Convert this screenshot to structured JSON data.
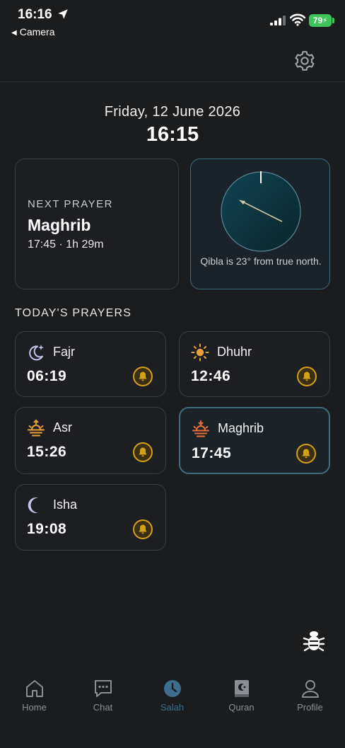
{
  "status_bar": {
    "time": "16:16",
    "back_label": "Camera",
    "battery": "79"
  },
  "header": {
    "date": "Friday, 12 June 2026",
    "clock": "16:15"
  },
  "next_prayer": {
    "label": "NEXT PRAYER",
    "name": "Maghrib",
    "time_info": "17:45 · 1h 29m"
  },
  "qibla": {
    "text": "Qibla is 23° from true north.",
    "degrees": 23
  },
  "prayers_section": {
    "title": "TODAY'S PRAYERS",
    "items": [
      {
        "name": "Fajr",
        "time": "06:19",
        "icon": "moon-star-icon",
        "active": false
      },
      {
        "name": "Dhuhr",
        "time": "12:46",
        "icon": "sun-icon",
        "active": false
      },
      {
        "name": "Asr",
        "time": "15:26",
        "icon": "sunset-icon",
        "active": false
      },
      {
        "name": "Maghrib",
        "time": "17:45",
        "icon": "sunset-down-icon",
        "active": true
      },
      {
        "name": "Isha",
        "time": "19:08",
        "icon": "crescent-moon-icon",
        "active": false
      }
    ]
  },
  "tabs": [
    {
      "label": "Home",
      "icon": "home-icon",
      "active": false
    },
    {
      "label": "Chat",
      "icon": "chat-icon",
      "active": false
    },
    {
      "label": "Salah",
      "icon": "clock-icon",
      "active": true
    },
    {
      "label": "Quran",
      "icon": "book-icon",
      "active": false
    },
    {
      "label": "Profile",
      "icon": "profile-icon",
      "active": false
    }
  ],
  "colors": {
    "background": "#1a1c1e",
    "accent": "#3d6b7e",
    "bell": "#d4a017",
    "icon_lavender": "#c5c3ec",
    "icon_orange": "#e8a03a"
  }
}
